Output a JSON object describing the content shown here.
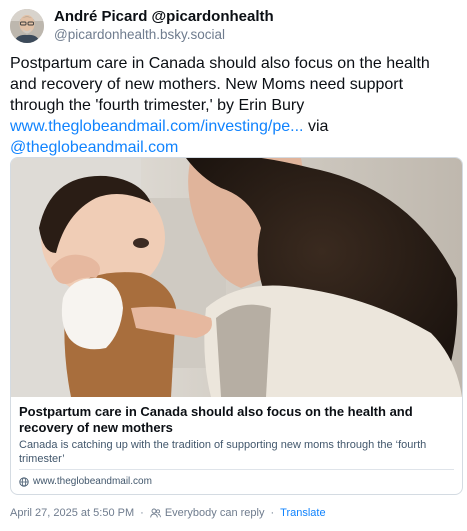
{
  "author": {
    "display_name": "André Picard @picardonhealth",
    "handle": "@picardonhealth.bsky.social",
    "avatar_icon": "author-avatar"
  },
  "post": {
    "text_1": "Postpartum care in Canada should also focus on the health and recovery of new mothers. New Moms need support through the 'fourth trimester,' by Erin Bury",
    "link_text": "www.theglobeandmail.com/investing/pe...",
    "via_text": " via",
    "mention_text": "@theglobeandmail.com"
  },
  "link_card": {
    "title": "Postpartum care in Canada should also focus on the health and recovery of new mothers",
    "description": "Canada is catching up with the tradition of supporting new moms through the ‘fourth trimester’",
    "domain": "www.theglobeandmail.com",
    "domain_icon": "globe-icon",
    "image_icon": "mother-and-baby-photo"
  },
  "meta": {
    "timestamp": "April 27, 2025 at 5:50 PM",
    "separator": "·",
    "reply_setting": "Everybody can reply",
    "reply_icon": "people-icon",
    "translate_label": "Translate"
  },
  "colors": {
    "link": "#1083fe",
    "muted": "#6f7c8e",
    "border": "#d4dbe2"
  }
}
